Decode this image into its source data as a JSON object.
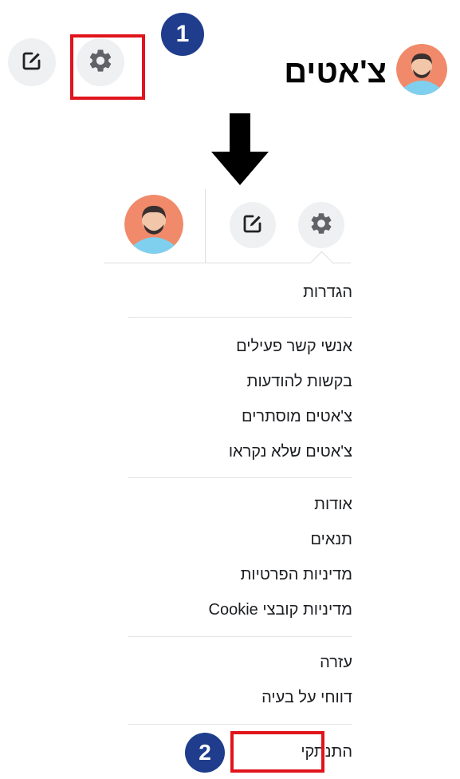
{
  "header": {
    "title": "צ'אטים",
    "settings_icon": "gear-icon",
    "compose_icon": "compose-icon",
    "avatar_icon": "user-avatar"
  },
  "steps": {
    "first": "1",
    "second": "2"
  },
  "colors": {
    "highlight": "#e0141b",
    "badge": "#1f3d8c",
    "button_bg": "#eef0f2",
    "arrow": "#000000"
  },
  "dropdown": {
    "settings_label": "הגדרות",
    "group_chats": [
      "אנשי קשר פעילים",
      "בקשות להודעות",
      "צ'אטים מוסתרים",
      "צ'אטים שלא נקראו"
    ],
    "group_info": [
      "אודות",
      "תנאים",
      "מדיניות הפרטיות",
      "מדיניות קובצי Cookie"
    ],
    "group_help": [
      "עזרה",
      "דווחי על בעיה"
    ],
    "logout_label": "התנתקי"
  }
}
